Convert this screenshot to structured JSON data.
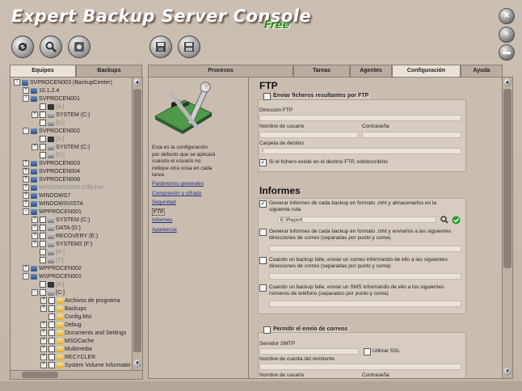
{
  "app": {
    "title": "Expert Backup Server Console",
    "edition": "Free"
  },
  "window_buttons": [
    {
      "name": "close-icon",
      "glyph": "✕"
    },
    {
      "name": "minimize-icon",
      "glyph": ""
    },
    {
      "name": "maximize-icon",
      "glyph": ""
    }
  ],
  "toolbar": [
    "refresh-icon",
    "search-icon",
    "settings-icon",
    "save-icon",
    "save-all-icon"
  ],
  "left_tabs": [
    {
      "label": "Equipos",
      "active": true
    },
    {
      "label": "Backups",
      "active": false
    }
  ],
  "tree": [
    {
      "indent": 0,
      "pm": "-",
      "check": false,
      "icon": "pc",
      "label": "SVPROCEN003 (BackupCenter)",
      "grey": false
    },
    {
      "indent": 1,
      "pm": "+",
      "check": false,
      "icon": "pc",
      "label": "10.1.2.4",
      "grey": false
    },
    {
      "indent": 1,
      "pm": "-",
      "check": false,
      "icon": "pc",
      "label": "SVPROCEN001",
      "grey": false
    },
    {
      "indent": 2,
      "pm": "",
      "check": true,
      "icon": "flp",
      "label": "[A:]",
      "grey": true
    },
    {
      "indent": 2,
      "pm": "+",
      "check": true,
      "icon": "drv",
      "label": "SYSTEM (C:)",
      "grey": false
    },
    {
      "indent": 2,
      "pm": "",
      "check": true,
      "icon": "drv",
      "label": "[D:]",
      "grey": true
    },
    {
      "indent": 1,
      "pm": "-",
      "check": false,
      "icon": "pc",
      "label": "SVPROCEN002",
      "grey": false
    },
    {
      "indent": 2,
      "pm": "",
      "check": true,
      "icon": "flp",
      "label": "[A:]",
      "grey": true
    },
    {
      "indent": 2,
      "pm": "+",
      "check": true,
      "icon": "drv",
      "label": "SYSTEM (C:)",
      "grey": false
    },
    {
      "indent": 2,
      "pm": "",
      "check": true,
      "icon": "drv",
      "label": "[D:]",
      "grey": true
    },
    {
      "indent": 1,
      "pm": "+",
      "check": false,
      "icon": "pc",
      "label": "SVPROCEN003",
      "grey": false
    },
    {
      "indent": 1,
      "pm": "+",
      "check": false,
      "icon": "pc",
      "label": "SVPROCEN004",
      "grey": false
    },
    {
      "indent": 1,
      "pm": "+",
      "check": false,
      "icon": "pc",
      "label": "SVPROCEN008",
      "grey": false
    },
    {
      "indent": 1,
      "pm": "+",
      "check": false,
      "icon": "pc",
      "label": "WINDOWS2000 (OffLine)",
      "grey": true
    },
    {
      "indent": 1,
      "pm": "+",
      "check": false,
      "icon": "pc",
      "label": "WINDOWS7",
      "grey": false
    },
    {
      "indent": 1,
      "pm": "+",
      "check": false,
      "icon": "pc",
      "label": "WINDOWSVISTA",
      "grey": false
    },
    {
      "indent": 1,
      "pm": "-",
      "check": false,
      "icon": "pc",
      "label": "WPPROCEN001",
      "grey": false
    },
    {
      "indent": 2,
      "pm": "+",
      "check": true,
      "icon": "drv",
      "label": "SYSTEM (C:)",
      "grey": false
    },
    {
      "indent": 2,
      "pm": "+",
      "check": true,
      "icon": "drv",
      "label": "DATA (D:)",
      "grey": false
    },
    {
      "indent": 2,
      "pm": "+",
      "check": true,
      "icon": "drv",
      "label": "RECOVERY (E:)",
      "grey": false
    },
    {
      "indent": 2,
      "pm": "+",
      "check": true,
      "icon": "drv",
      "label": "SYSTEM2 (F:)",
      "grey": false
    },
    {
      "indent": 2,
      "pm": "",
      "check": true,
      "icon": "drv",
      "label": "[R:]",
      "grey": true
    },
    {
      "indent": 2,
      "pm": "",
      "check": true,
      "icon": "drv",
      "label": "[T:]",
      "grey": true
    },
    {
      "indent": 1,
      "pm": "+",
      "check": false,
      "icon": "pc",
      "label": "WPPROCEN002",
      "grey": false
    },
    {
      "indent": 1,
      "pm": "-",
      "check": false,
      "icon": "pc",
      "label": "WSPROCEN001",
      "grey": false
    },
    {
      "indent": 2,
      "pm": "",
      "check": true,
      "icon": "flp",
      "label": "[A:]",
      "grey": true
    },
    {
      "indent": 2,
      "pm": "-",
      "check": true,
      "icon": "drv",
      "label": "[C:]",
      "grey": false
    },
    {
      "indent": 3,
      "pm": "+",
      "check": true,
      "icon": "fld",
      "label": "Archivos de programa",
      "grey": false
    },
    {
      "indent": 3,
      "pm": "+",
      "check": true,
      "icon": "fld",
      "label": "Backups",
      "grey": false
    },
    {
      "indent": 3,
      "pm": "",
      "check": true,
      "icon": "fld",
      "label": "Config.Msi",
      "grey": false
    },
    {
      "indent": 3,
      "pm": "+",
      "check": true,
      "icon": "fld",
      "label": "Debug",
      "grey": false
    },
    {
      "indent": 3,
      "pm": "+",
      "check": true,
      "icon": "fld",
      "label": "Documents and Settings",
      "grey": false
    },
    {
      "indent": 3,
      "pm": "+",
      "check": true,
      "icon": "fld",
      "label": "MSOCache",
      "grey": false
    },
    {
      "indent": 3,
      "pm": "+",
      "check": true,
      "icon": "fld",
      "label": "Multimedia",
      "grey": false
    },
    {
      "indent": 3,
      "pm": "+",
      "check": true,
      "icon": "fld",
      "label": "RECYCLER",
      "grey": false
    },
    {
      "indent": 3,
      "pm": "+",
      "check": true,
      "icon": "fld",
      "label": "System Volume Informatio",
      "grey": false
    }
  ],
  "right_tabs": [
    {
      "label": "Procesos",
      "active": false
    },
    {
      "label": "Tareas",
      "active": false
    },
    {
      "label": "Agentes",
      "active": false
    },
    {
      "label": "Configuración",
      "active": true
    },
    {
      "label": "Ayuda",
      "active": false
    }
  ],
  "info": {
    "description": "Esta es la configuración por defecto que se aplicará cuando el usuario no indique otra cosa en cada tarea",
    "links": [
      {
        "label": "Parámetros generales",
        "selected": false
      },
      {
        "label": "Compresión y cifrado",
        "selected": false
      },
      {
        "label": "Seguridad",
        "selected": false
      },
      {
        "label": "FTP",
        "selected": true
      },
      {
        "label": "Informes",
        "selected": false
      },
      {
        "label": "Apariencia",
        "selected": false
      }
    ]
  },
  "ftp": {
    "heading": "FTP",
    "group_label": "Enviar ficheros resultantes por FTP",
    "address_label": "Dirección FTP",
    "address_value": "",
    "user_label": "Nombre de usuario",
    "password_label": "Contraseña",
    "folder_label": "Carpeta de destino",
    "folder_value": "/",
    "overwrite_label": "Si el fichero existe en el destino FTP, sobrescribirlo"
  },
  "reports": {
    "heading": "Informes",
    "opt1": "Generar informes de cada backup en formato .mht y almacenarlos en la siguiente ruta",
    "path_value": "E:\\Report",
    "opt2": "Generar informes de cada backup en formato .mht y enviarlos a las siguientes direcciones de correo (separadas por punto y coma)",
    "opt3": "Cuando un backup falle, enviar un correo informando de ello a las siguientes direcciones de correo (separadas por punto y coma)",
    "opt4": "Cuando un backup falle, enviar un SMS informando de ello a los siguientes números de teléfono (separados por punto y coma)"
  },
  "mail": {
    "group_label": "Permitir el envío de correos",
    "smtp_label": "Servidor SMTP",
    "ssl_label": "Utilizar SSL",
    "sender_label": "Nombre de cuenta del remitente",
    "user_label": "Nombre de usuario",
    "password_label": "Contraseña"
  }
}
